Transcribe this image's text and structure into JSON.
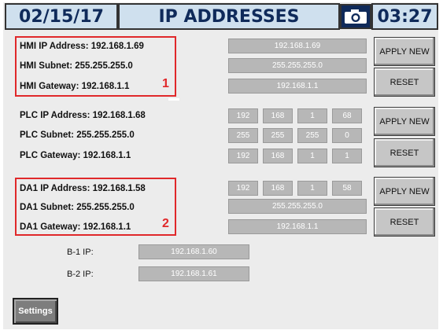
{
  "header": {
    "date": "02/15/17",
    "title": "IP ADDRESSES",
    "time": "03:27",
    "camera_icon": "camera-icon"
  },
  "hmi": {
    "ip_label": "HMI IP Address: 192.168.1.69",
    "subnet_label": "HMI Subnet: 255.255.255.0",
    "gateway_label": "HMI Gateway: 192.168.1.1",
    "ip_value": "192.168.1.69",
    "subnet_value": "255.255.255.0",
    "gateway_value": "192.168.1.1",
    "apply_label": "APPLY NEW",
    "reset_label": "RESET",
    "annotation_number": "1"
  },
  "plc": {
    "ip_label": "PLC IP Address: 192.168.1.68",
    "subnet_label": "PLC Subnet: 255.255.255.0",
    "gateway_label": "PLC Gateway: 192.168.1.1",
    "ip_octets": [
      "192",
      "168",
      "1",
      "68"
    ],
    "subnet_octets": [
      "255",
      "255",
      "255",
      "0"
    ],
    "gateway_octets": [
      "192",
      "168",
      "1",
      "1"
    ],
    "apply_label": "APPLY NEW",
    "reset_label": "RESET"
  },
  "da1": {
    "ip_label": "DA1 IP Address: 192.168.1.58",
    "subnet_label": "DA1 Subnet: 255.255.255.0",
    "gateway_label": "DA1 Gateway: 192.168.1.1",
    "ip_octets": [
      "192",
      "168",
      "1",
      "58"
    ],
    "subnet_value": "255.255.255.0",
    "gateway_value": "192.168.1.1",
    "apply_label": "APPLY NEW",
    "reset_label": "RESET",
    "annotation_number": "2"
  },
  "b_devices": {
    "b1_label": "B-1 IP:",
    "b1_value": "192.168.1.60",
    "b2_label": "B-2 IP:",
    "b2_value": "192.168.1.61"
  },
  "footer": {
    "settings_label": "Settings"
  },
  "colors": {
    "header_bg": "#cfe0ee",
    "header_text": "#0f2a5a",
    "annotation_red": "#e0282a",
    "field_bg": "#b7b7b7"
  }
}
